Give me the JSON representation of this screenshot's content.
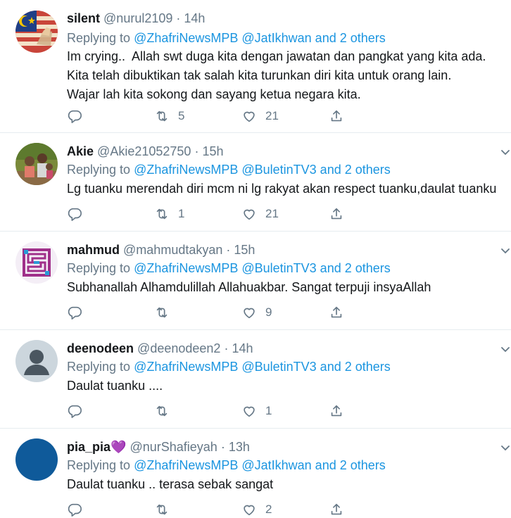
{
  "tweets": [
    {
      "name": "silent",
      "handle": "@nurul2109",
      "time": "14h",
      "reply_prefix": "Replying to ",
      "mentions": "@ZhafriNewsMPB @JatIkhwan and 2 others",
      "text": "Im crying..  Allah swt duga kita dengan jawatan dan pangkat yang kita ada.\nKita telah dibuktikan tak salah kita turunkan diri kita untuk orang lain.\nWajar lah kita sokong dan sayang ketua negara kita.",
      "retweets": "5",
      "likes": "21",
      "avatar_icon": "malaysia-flag-avatar"
    },
    {
      "name": "Akie",
      "handle": "@Akie21052750",
      "time": "15h",
      "reply_prefix": "Replying to ",
      "mentions": "@ZhafriNewsMPB @BuletinTV3 and 2 others",
      "text": "Lg tuanku merendah diri mcm ni lg rakyat akan respect tuanku,daulat tuanku",
      "retweets": "1",
      "likes": "21",
      "avatar_icon": "kids-photo-avatar"
    },
    {
      "name": "mahmud",
      "handle": "@mahmudtakyan",
      "time": "15h",
      "reply_prefix": "Replying to ",
      "mentions": "@ZhafriNewsMPB @BuletinTV3 and 2 others",
      "text": "Subhanallah Alhamdulillah Allahuakbar. Sangat terpuji insyaAllah",
      "retweets": "",
      "likes": "9",
      "avatar_icon": "kufic-calligraphy-avatar"
    },
    {
      "name": "deenodeen",
      "handle": "@deenodeen2",
      "time": "14h",
      "reply_prefix": "Replying to ",
      "mentions": "@ZhafriNewsMPB @BuletinTV3 and 2 others",
      "text": "Daulat tuanku ....",
      "retweets": "",
      "likes": "1",
      "avatar_icon": "default-user-avatar"
    },
    {
      "name": "pia_pia",
      "name_emoji": "💜",
      "handle": "@nurShafieyah",
      "time": "13h",
      "reply_prefix": "Replying to ",
      "mentions": "@ZhafriNewsMPB @JatIkhwan and 2 others",
      "text": "Daulat tuanku .. terasa sebak sangat",
      "retweets": "",
      "likes": "2",
      "avatar_icon": "blue-circle-avatar"
    }
  ],
  "separator": "·",
  "colors": {
    "link": "#1b95e0",
    "muted": "#657786",
    "text": "#14171a",
    "border": "#e6ecf0"
  }
}
